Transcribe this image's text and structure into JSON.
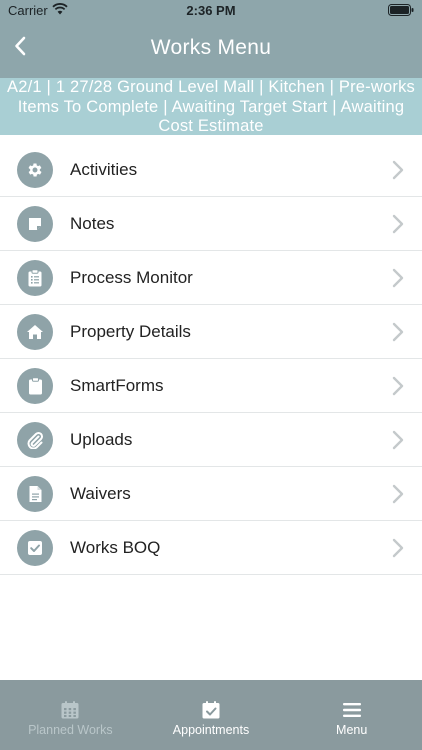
{
  "status_bar": {
    "carrier": "Carrier",
    "time": "2:36 PM"
  },
  "nav": {
    "title": "Works Menu",
    "back_icon": "chevron-left-icon"
  },
  "context_banner": "A2/1 | 1 27/28 Ground Level Mall | Kitchen | Pre-works Items To Complete | Awaiting Target Start | Awaiting Cost Estimate",
  "menu": {
    "items": [
      {
        "label": "Activities",
        "icon": "gear-icon"
      },
      {
        "label": "Notes",
        "icon": "note-icon"
      },
      {
        "label": "Process Monitor",
        "icon": "clipboard-list-icon"
      },
      {
        "label": "Property Details",
        "icon": "home-icon"
      },
      {
        "label": "SmartForms",
        "icon": "clipboard-icon"
      },
      {
        "label": "Uploads",
        "icon": "paperclip-icon"
      },
      {
        "label": "Waivers",
        "icon": "document-icon"
      },
      {
        "label": "Works BOQ",
        "icon": "check-square-icon"
      }
    ]
  },
  "tabs": [
    {
      "label": "Planned Works",
      "icon": "calendar-grid-icon",
      "active": false
    },
    {
      "label": "Appointments",
      "icon": "calendar-check-icon",
      "active": true
    },
    {
      "label": "Menu",
      "icon": "menu-icon",
      "active": true
    }
  ],
  "colors": {
    "header": "#8ea6ab",
    "banner": "#a9cfd4",
    "icon_circle": "#8fa3a8",
    "tab_bar": "#8a9a9e"
  }
}
